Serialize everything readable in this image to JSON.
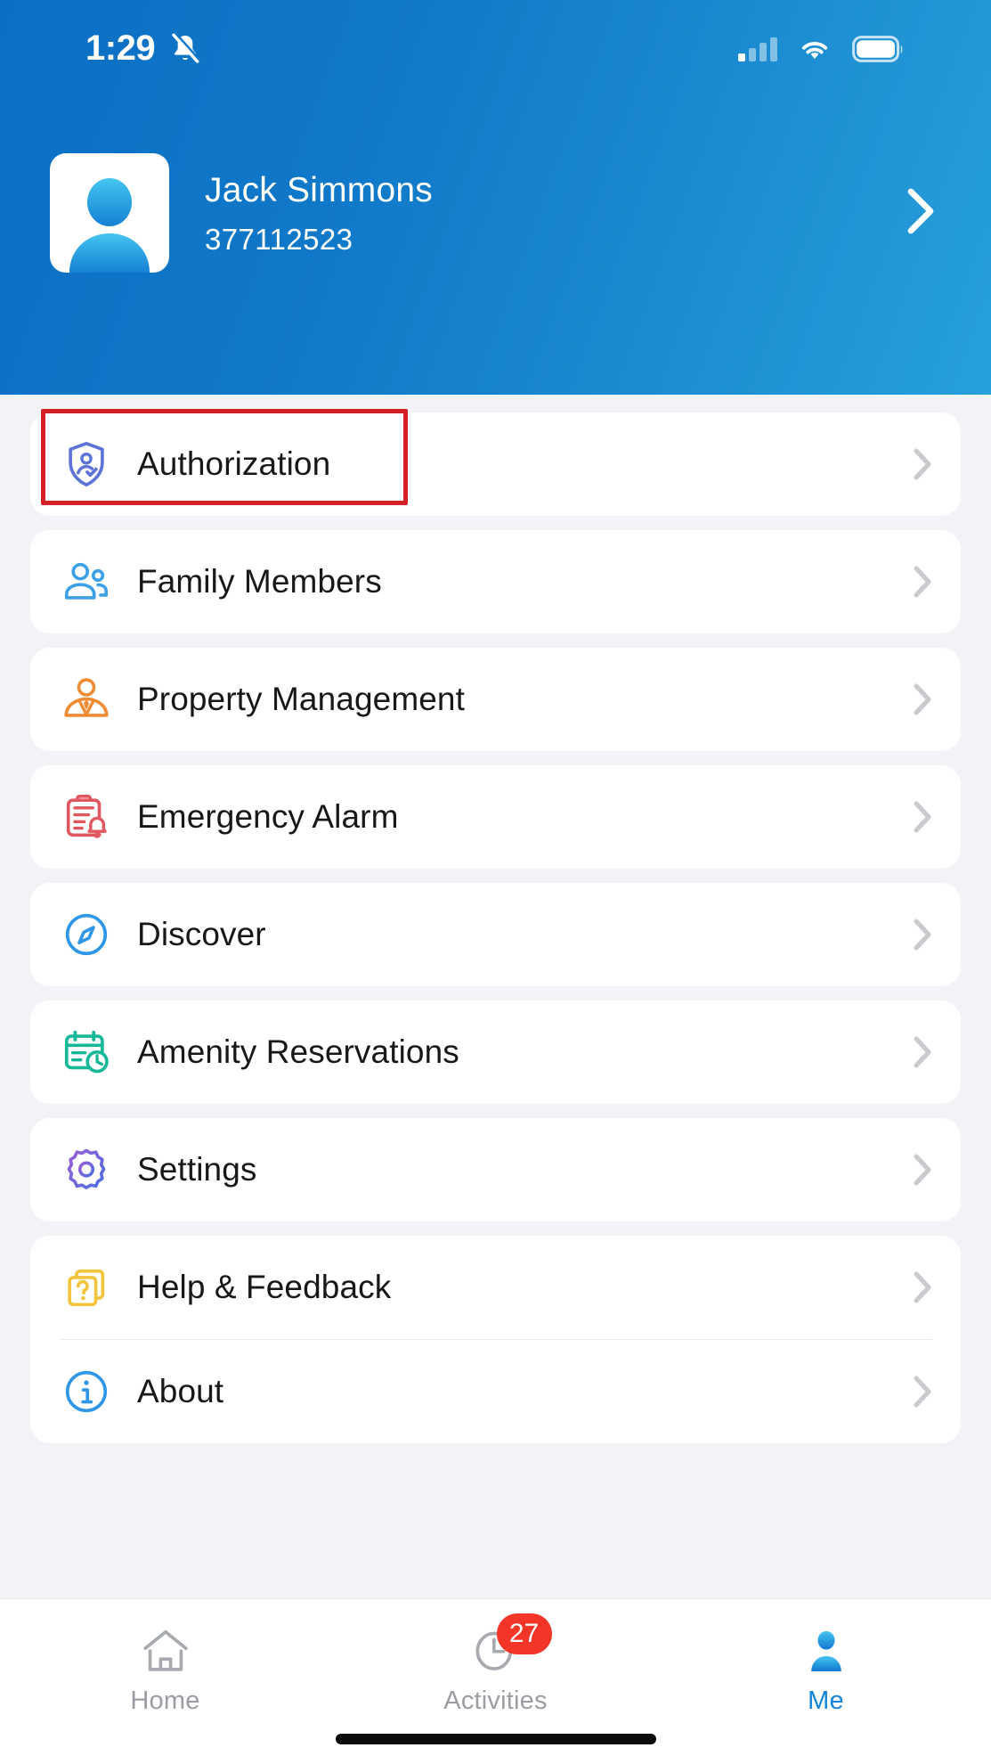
{
  "status_bar": {
    "time": "1:29",
    "mute_icon": "bell-slash-icon",
    "signal_icon": "cellular-signal-icon",
    "wifi_icon": "wifi-icon",
    "battery_icon": "battery-icon"
  },
  "header": {
    "accent_color": "#0b6fc4",
    "gradient_end_color": "#27a0dc",
    "avatar_icon": "user-avatar-icon",
    "name": "Jack Simmons",
    "account_id": "377112523",
    "chevron_icon": "chevron-right-icon"
  },
  "highlight": {
    "color": "#d32027",
    "target": "Authorization"
  },
  "menu": {
    "groups": [
      {
        "items": [
          {
            "label": "Authorization",
            "icon": "shield-person-icon",
            "color": "#5b72d8",
            "highlighted": true
          }
        ]
      },
      {
        "items": [
          {
            "label": "Family Members",
            "icon": "people-group-icon",
            "color": "#3ca0e8"
          }
        ]
      },
      {
        "items": [
          {
            "label": "Property Management",
            "icon": "manager-person-icon",
            "color": "#ef8b33"
          }
        ]
      },
      {
        "items": [
          {
            "label": "Emergency Alarm",
            "icon": "clipboard-bell-icon",
            "color": "#e0575f"
          }
        ]
      },
      {
        "items": [
          {
            "label": "Discover",
            "icon": "compass-icon",
            "color": "#2f96e8"
          }
        ]
      },
      {
        "items": [
          {
            "label": "Amenity Reservations",
            "icon": "calendar-clock-icon",
            "color": "#17b897"
          }
        ]
      },
      {
        "items": [
          {
            "label": "Settings",
            "icon": "gear-icon",
            "color": "#7b5fd4"
          }
        ]
      },
      {
        "items": [
          {
            "label": "Help & Feedback",
            "icon": "help-cards-icon",
            "color": "#f2c43b"
          },
          {
            "label": "About",
            "icon": "info-circle-icon",
            "color": "#2f96e8"
          }
        ]
      }
    ],
    "arrow_icon": "chevron-right-icon"
  },
  "tabbar": {
    "active_color": "#1184d8",
    "inactive_color": "#9a9da3",
    "badge_color": "#f33527",
    "tabs": [
      {
        "label": "Home",
        "icon": "home-icon",
        "active": false,
        "badge": ""
      },
      {
        "label": "Activities",
        "icon": "clock-icon",
        "active": false,
        "badge": "27"
      },
      {
        "label": "Me",
        "icon": "person-icon",
        "active": true,
        "badge": ""
      }
    ]
  }
}
